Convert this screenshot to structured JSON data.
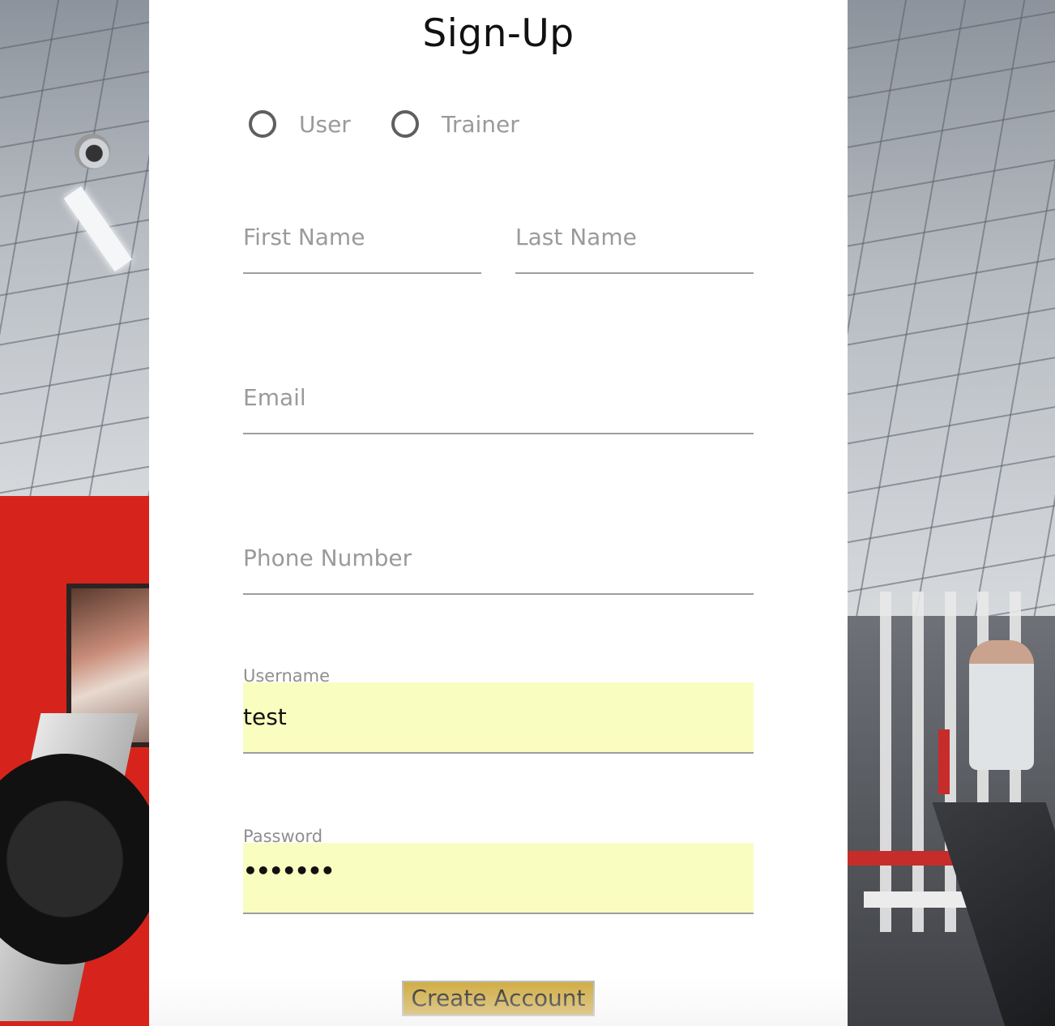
{
  "form": {
    "title": "Sign-Up",
    "role_options": [
      {
        "label": "User",
        "selected": false
      },
      {
        "label": "Trainer",
        "selected": false
      }
    ],
    "fields": {
      "first_name": {
        "placeholder": "First Name",
        "value": ""
      },
      "last_name": {
        "placeholder": "Last Name",
        "value": ""
      },
      "email": {
        "placeholder": "Email",
        "value": ""
      },
      "phone": {
        "placeholder": "Phone Number",
        "value": ""
      },
      "username": {
        "label": "Username",
        "value": "test"
      },
      "password": {
        "label": "Password",
        "value": "•••••••"
      }
    },
    "submit_label": "Create Account"
  },
  "colors": {
    "card_background": "#ffffff",
    "autofill_background": "#fafdc0",
    "button_background": "#cfa93a",
    "placeholder_text": "#9a9a9a"
  },
  "background": {
    "description_icon": "gym-photo"
  }
}
